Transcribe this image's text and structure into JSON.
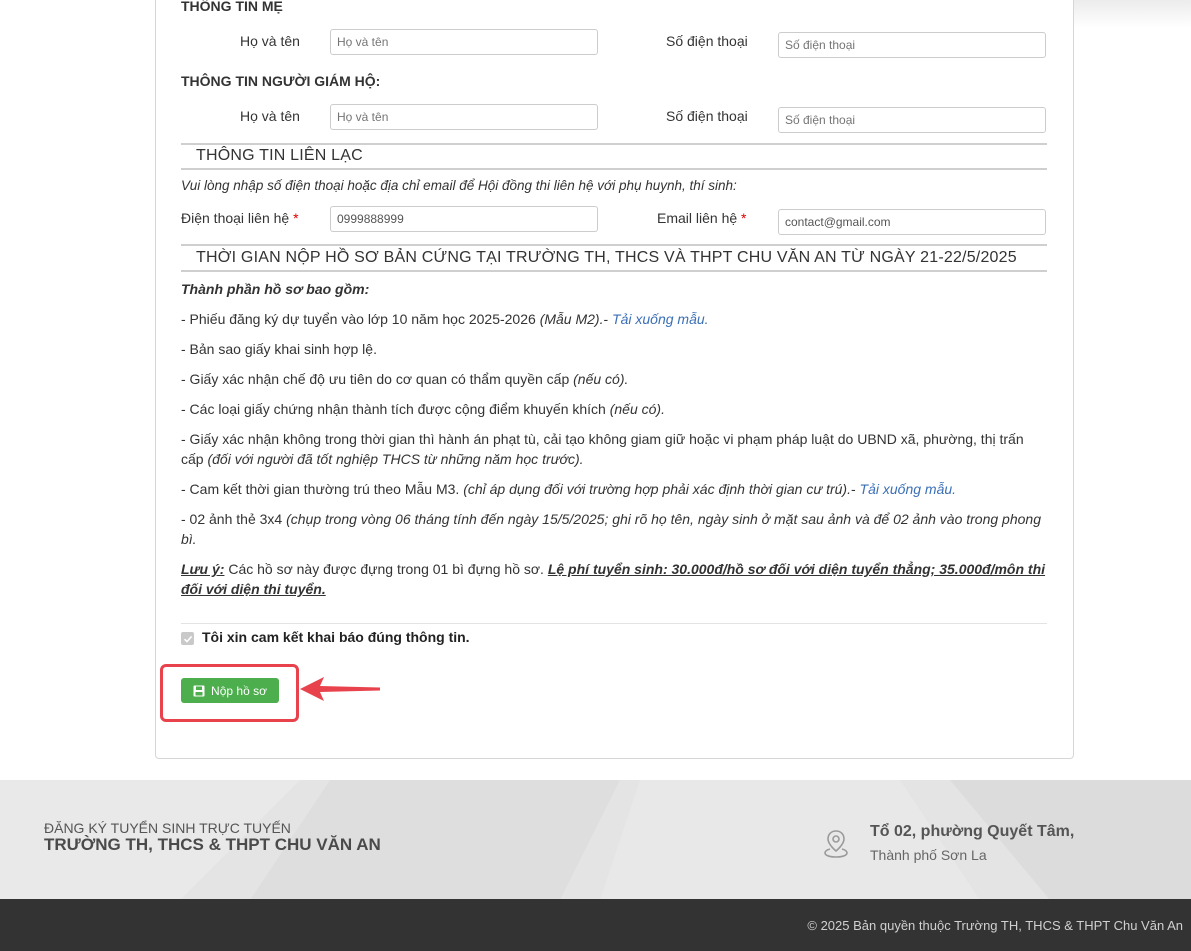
{
  "colors": {
    "accent_green": "#4cae4c",
    "link_blue": "#3b6fb6",
    "highlight_red": "#e8434c",
    "footer_bg": "#e4e4e4",
    "bottom_bar_bg": "#333333"
  },
  "mother": {
    "title": "THÔNG TIN MẸ",
    "name_label": "Họ và tên",
    "name_placeholder": "Họ và tên",
    "phone_label": "Số điện thoại",
    "phone_placeholder": "Số điện thoại"
  },
  "guardian": {
    "title": "THÔNG TIN NGƯỜI GIÁM HỘ:",
    "name_label": "Họ và tên",
    "name_placeholder": "Họ và tên",
    "phone_label": "Số điện thoại",
    "phone_placeholder": "Số điện thoại"
  },
  "contact": {
    "heading": "THÔNG TIN LIÊN LẠC",
    "note": "Vui lòng nhập số điện thoại hoặc địa chỉ email để Hội đồng thi liên hệ với phụ huynh, thí sinh:",
    "phone_label": "Điện thoại liên hệ",
    "phone_value": "0999888999",
    "email_label": "Email liên hệ",
    "email_value": "contact@gmail.com",
    "required_mark": "*"
  },
  "documents": {
    "heading": "THỜI GIAN NỘP HỒ SƠ BẢN CỨNG TẠI TRƯỜNG TH, THCS VÀ THPT CHU VĂN AN TỪ NGÀY 21-22/5/2025",
    "intro": "Thành phần hồ sơ bao gồm:",
    "item1_text": "- Phiếu đăng ký dự tuyển vào lớp 10 năm học 2025-2026 ",
    "item1_note": "(Mẫu M2).",
    "item1_sep": "- ",
    "item1_link": "Tải xuống mẫu.",
    "item2_text": "- Bản sao giấy khai sinh hợp lệ.",
    "item3_text": "- Giấy xác nhận chế độ ưu tiên do cơ quan có thẩm quyền cấp ",
    "item3_note": "(nếu có).",
    "item4_text": "- Các loại giấy chứng nhận thành tích được cộng điểm khuyến khích ",
    "item4_note": "(nếu có).",
    "item5_line1": "- Giấy xác nhận không trong thời gian thì hành án phạt tù, cải tạo không giam giữ hoặc vi phạm pháp luật do UBND xã, phường, thị trấn",
    "item5_line2_text": "cấp ",
    "item5_line2_note": "(đối với người đã tốt nghiệp THCS từ những năm học trước).",
    "item6_text": "- Cam kết thời gian thường trú theo Mẫu M3. ",
    "item6_note": "(chỉ áp dụng đối với trường hợp phải xác định thời gian cư trú).",
    "item6_sep": "- ",
    "item6_link": "Tải xuống mẫu.",
    "item7_text": "- 02 ảnh thẻ 3x4 ",
    "item7_note_line1": "(chụp trong vòng 06 tháng tính đến ngày 15/5/2025; ghi rõ họ tên, ngày sinh ở mặt sau ảnh và để 02 ảnh vào trong phong",
    "item7_note_line2": "bì.",
    "note_label": "Lưu ý:",
    "note_text": " Các hồ sơ này được đựng trong 01 bì đựng hồ sơ. ",
    "fee_line1": "Lệ phí tuyển sinh: 30.000đ/hồ sơ đối với diện tuyển thẳng; 35.000đ/môn thi",
    "fee_line2": "đối với diện thi tuyển."
  },
  "commit": {
    "label": "Tôi xin cam kết khai báo đúng thông tin.",
    "checked": true
  },
  "submit": {
    "label": "Nộp hồ sơ"
  },
  "footer": {
    "line1": "ĐĂNG KÝ TUYỂN SINH TRỰC TUYẾN",
    "line2": "TRƯỜNG TH, THCS & THPT CHU VĂN AN",
    "address_line1": "Tổ 02, phường Quyết Tâm,",
    "address_line2": "Thành phố Sơn La",
    "copyright": "© 2025 Bản quyền thuộc Trường TH, THCS & THPT Chu Văn An"
  }
}
